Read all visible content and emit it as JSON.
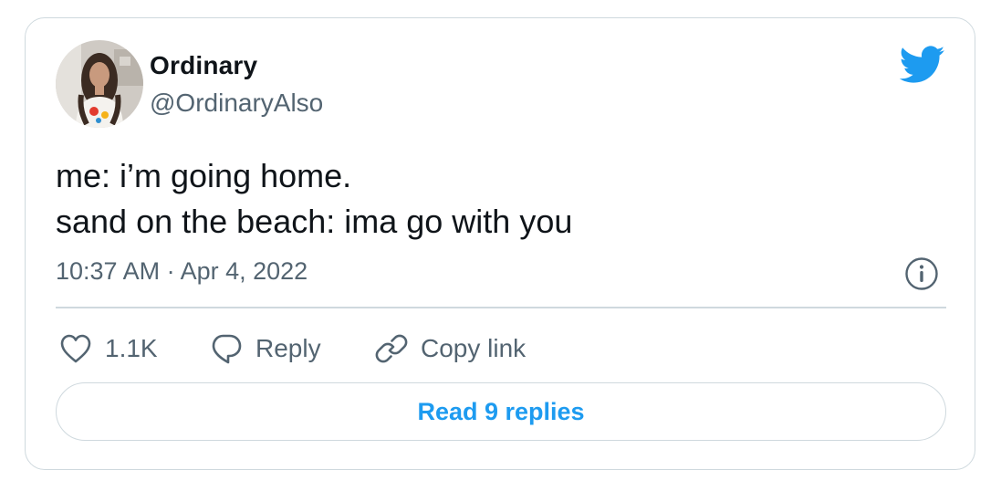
{
  "author": {
    "display_name": "Ordinary",
    "handle": "@OrdinaryAlso",
    "avatar_icon": "user-avatar-photo"
  },
  "brand": {
    "icon": "twitter-bird-icon",
    "color": "#1d9bf0"
  },
  "tweet": {
    "line1": "me: i’m going home.",
    "line2": "sand on the beach: ima go with you",
    "timestamp": "10:37 AM · Apr 4, 2022"
  },
  "actions": {
    "like_count": "1.1K",
    "reply_label": "Reply",
    "copy_link_label": "Copy link"
  },
  "footer": {
    "read_replies_label": "Read 9 replies"
  },
  "colors": {
    "text": "#0f1419",
    "secondary": "#536471",
    "border": "#cfd9de",
    "accent": "#1d9bf0"
  }
}
